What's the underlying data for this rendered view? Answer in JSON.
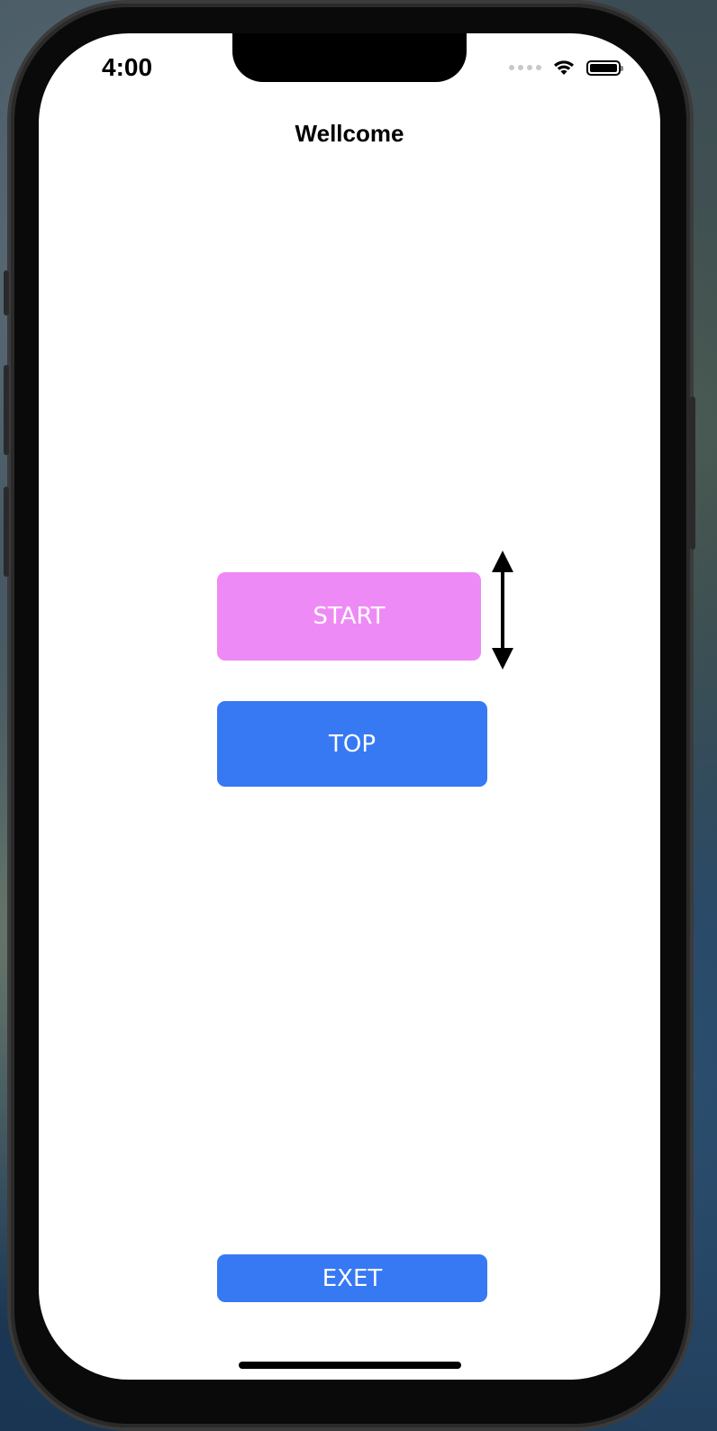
{
  "status_bar": {
    "time": "4:00"
  },
  "screen": {
    "title": "Wellcome"
  },
  "buttons": {
    "start_label": "START",
    "top_label": "TOP",
    "exit_label": "EXET"
  },
  "icons": {
    "signal": "cellular-signal-icon",
    "wifi": "wifi-icon",
    "battery": "battery-icon",
    "resize": "vertical-double-arrow-icon"
  },
  "colors": {
    "start_button": "#ee8af6",
    "primary_button": "#3779f3",
    "background": "#ffffff"
  }
}
